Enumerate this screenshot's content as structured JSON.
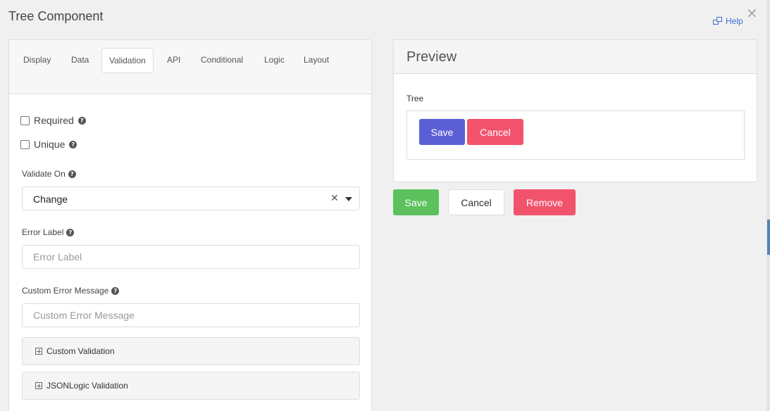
{
  "dialog": {
    "title": "Tree Component",
    "help_label": "Help",
    "close_glyph": "✕"
  },
  "tabs": [
    {
      "label": "Display",
      "active": false
    },
    {
      "label": "Data",
      "active": false
    },
    {
      "label": "Validation",
      "active": true
    },
    {
      "label": "API",
      "active": false
    },
    {
      "label": "Conditional",
      "active": false
    },
    {
      "label": "Logic",
      "active": false
    },
    {
      "label": "Layout",
      "active": false
    }
  ],
  "validation": {
    "required_label": "Required",
    "unique_label": "Unique",
    "validate_on_label": "Validate On",
    "validate_on_value": "Change",
    "error_label_label": "Error Label",
    "error_label_placeholder": "Error Label",
    "custom_error_label": "Custom Error Message",
    "custom_error_placeholder": "Custom Error Message",
    "custom_validation_label": "Custom Validation",
    "jsonlogic_validation_label": "JSONLogic Validation"
  },
  "preview": {
    "title": "Preview",
    "tree_label": "Tree",
    "tree_save_label": "Save",
    "tree_cancel_label": "Cancel"
  },
  "actions": {
    "save_label": "Save",
    "cancel_label": "Cancel",
    "remove_label": "Remove"
  },
  "colors": {
    "primary": "#5b5fd6",
    "danger": "#f2536c",
    "success": "#5cc15d",
    "link": "#3b6fd4"
  }
}
